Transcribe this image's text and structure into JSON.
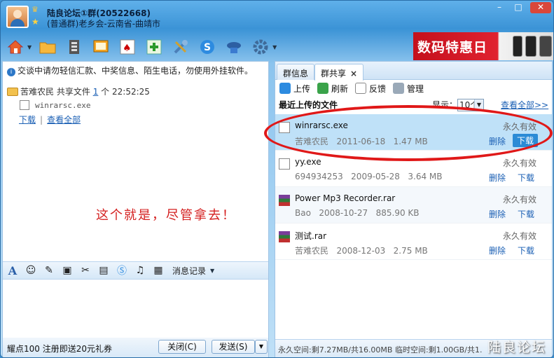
{
  "window": {
    "title": "陆良论坛①群(20522668)",
    "subtitle": "(普通群)老乡会-云南省-曲靖市"
  },
  "toolbar": {
    "icons": [
      "home-icon",
      "folder-icon",
      "album-icon",
      "screen-icon",
      "game-icon",
      "add-icon",
      "tools-icon",
      "soso-icon",
      "hat-icon",
      "gear-icon"
    ]
  },
  "banner": {
    "text": "数码特惠日"
  },
  "left": {
    "notice": "交谈中请勿轻信汇款、中奖信息、陌生电话，勿使用外挂软件。",
    "msg": {
      "sender": "苦难农民",
      "action": "共享文件",
      "count": "1",
      "unit": "个",
      "time": "22:52:25"
    },
    "msg_file": "winrarsc.exe",
    "download_link": "下载",
    "view_all_link": "查看全部",
    "hint": "这个就是，尽管拿去！",
    "history_label": "消息记录",
    "promo": "耀点100 注册即送20元礼券",
    "close_label": "关闭(C)",
    "send_label": "发送(S)"
  },
  "right": {
    "tabs": [
      {
        "label": "群信息"
      },
      {
        "label": "群共享"
      }
    ],
    "tab_close": "×",
    "actions": {
      "upload": "上传",
      "refresh": "刷新",
      "feedback": "反馈",
      "manage": "管理"
    },
    "recent_title": "最近上传的文件",
    "show_label": "显示：",
    "show_value": "10个",
    "view_all": "查看全部>>",
    "files": [
      {
        "name": "winrarsc.exe",
        "uploader": "苦难农民",
        "date": "2011-06-18",
        "size": "1.47 MB",
        "validity": "永久有效",
        "delete": "删除",
        "download": "下载"
      },
      {
        "name": "yy.exe",
        "uploader": "694934253",
        "date": "2009-05-28",
        "size": "3.64 MB",
        "validity": "永久有效",
        "delete": "删除",
        "download": "下载"
      },
      {
        "name": "Power Mp3 Recorder.rar",
        "uploader": "Bao",
        "date": "2008-10-27",
        "size": "885.90 KB",
        "validity": "永久有效",
        "delete": "删除",
        "download": "下载"
      },
      {
        "name": "测试.rar",
        "uploader": "苦难农民",
        "date": "2008-12-03",
        "size": "2.75 MB",
        "validity": "永久有效",
        "delete": "删除",
        "download": "下载"
      }
    ],
    "status": "永久空间:剩7.27MB/共16.00MB 临时空间:剩1.00GB/共1."
  },
  "watermark": "陆良论坛"
}
